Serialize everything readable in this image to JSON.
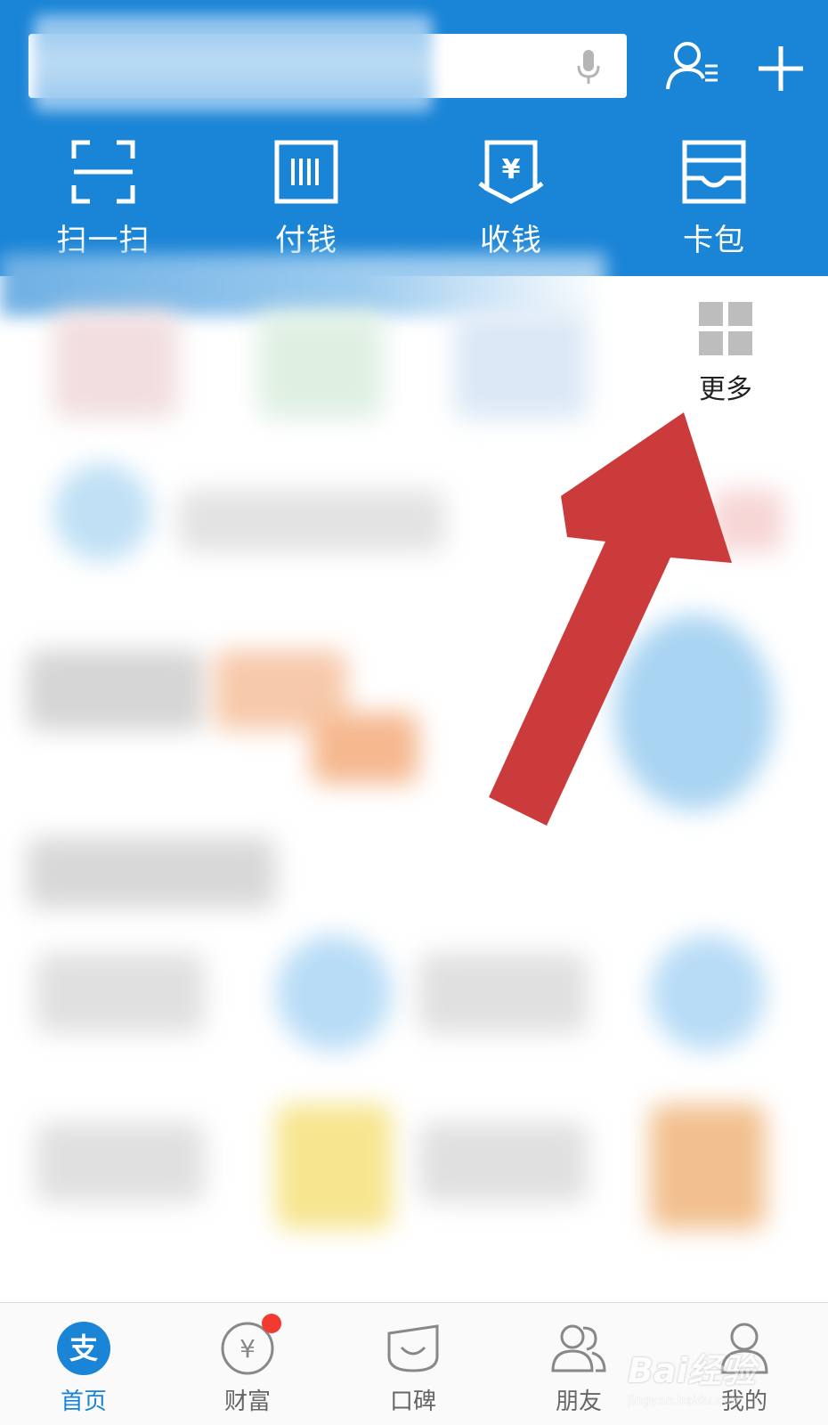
{
  "header": {
    "bg_color": "#1a84d6",
    "search": {
      "value": "",
      "icon": "microphone-icon"
    },
    "right_icons": [
      "contacts-icon",
      "plus-icon"
    ]
  },
  "quick_actions": [
    {
      "label": "扫一扫",
      "icon": "scan-icon"
    },
    {
      "label": "付钱",
      "icon": "pay-barcode-icon"
    },
    {
      "label": "收钱",
      "icon": "receive-money-icon"
    },
    {
      "label": "卡包",
      "icon": "card-wallet-icon"
    }
  ],
  "apps": {
    "more": {
      "label": "更多",
      "icon": "grid-icon"
    }
  },
  "annotation": {
    "color": "#cc3b3b",
    "icon": "red-arrow-icon"
  },
  "tabbar": {
    "active_color": "#1a84d6",
    "items": [
      {
        "label": "首页",
        "icon": "alipay-home-icon",
        "active": true
      },
      {
        "label": "财富",
        "icon": "wealth-yen-icon",
        "badge": true
      },
      {
        "label": "口碑",
        "icon": "koubei-icon"
      },
      {
        "label": "朋友",
        "icon": "friends-icon"
      },
      {
        "label": "我的",
        "icon": "profile-icon"
      }
    ]
  },
  "watermark": {
    "logo": "Bai经验",
    "url": "jingyan.baidu.com"
  }
}
